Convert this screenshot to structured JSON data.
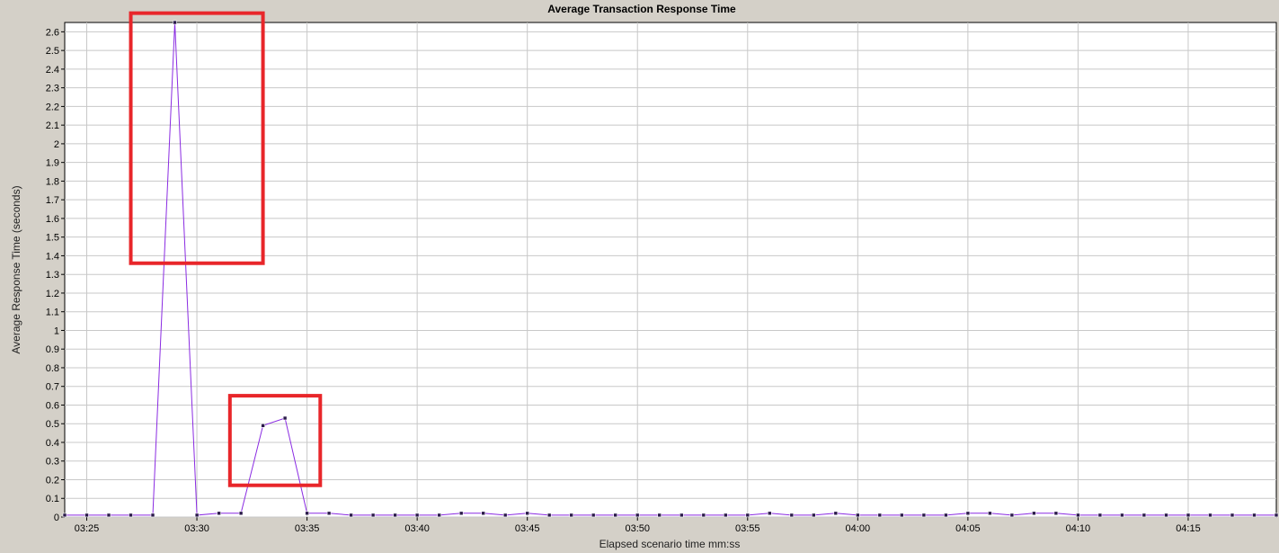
{
  "chart_data": {
    "type": "line",
    "title": "Average Transaction Response Time",
    "xlabel": "Elapsed scenario time mm:ss",
    "ylabel": "Average Response Time (seconds)",
    "x_unit": "mm:ss",
    "xlim": [
      "03:24",
      "04:19"
    ],
    "ylim": [
      0,
      2.65
    ],
    "x_ticks": [
      "03:25",
      "03:30",
      "03:35",
      "03:40",
      "03:45",
      "03:50",
      "03:55",
      "04:00",
      "04:05",
      "04:10",
      "04:15"
    ],
    "y_ticks": [
      "0",
      "0.1",
      "0.2",
      "0.3",
      "0.4",
      "0.5",
      "0.6",
      "0.7",
      "0.8",
      "0.9",
      "1",
      "1.1",
      "1.2",
      "1.3",
      "1.4",
      "1.5",
      "1.6",
      "1.7",
      "1.8",
      "1.9",
      "2",
      "2.1",
      "2.2",
      "2.3",
      "2.4",
      "2.5",
      "2.6"
    ],
    "grid": true,
    "series": [
      {
        "color": "#8a2be2",
        "x": [
          "03:24",
          "03:25",
          "03:26",
          "03:27",
          "03:28",
          "03:29",
          "03:30",
          "03:31",
          "03:32",
          "03:33",
          "03:34",
          "03:35",
          "03:36",
          "03:37",
          "03:38",
          "03:39",
          "03:40",
          "03:41",
          "03:42",
          "03:43",
          "03:44",
          "03:45",
          "03:46",
          "03:47",
          "03:48",
          "03:49",
          "03:50",
          "03:51",
          "03:52",
          "03:53",
          "03:54",
          "03:55",
          "03:56",
          "03:57",
          "03:58",
          "03:59",
          "04:00",
          "04:01",
          "04:02",
          "04:03",
          "04:04",
          "04:05",
          "04:06",
          "04:07",
          "04:08",
          "04:09",
          "04:10",
          "04:11",
          "04:12",
          "04:13",
          "04:14",
          "04:15",
          "04:16",
          "04:17",
          "04:18",
          "04:19"
        ],
        "y": [
          0.01,
          0.01,
          0.01,
          0.01,
          0.01,
          2.65,
          0.01,
          0.02,
          0.02,
          0.49,
          0.53,
          0.02,
          0.02,
          0.01,
          0.01,
          0.01,
          0.01,
          0.01,
          0.02,
          0.02,
          0.01,
          0.02,
          0.01,
          0.01,
          0.01,
          0.01,
          0.01,
          0.01,
          0.01,
          0.01,
          0.01,
          0.01,
          0.02,
          0.01,
          0.01,
          0.02,
          0.01,
          0.01,
          0.01,
          0.01,
          0.01,
          0.02,
          0.02,
          0.01,
          0.02,
          0.02,
          0.01,
          0.01,
          0.01,
          0.01,
          0.01,
          0.01,
          0.01,
          0.01,
          0.01,
          0.01
        ]
      }
    ],
    "annotations": [
      {
        "type": "rectangle",
        "color": "#e8262a",
        "x_range": [
          "03:27",
          "03:33"
        ],
        "y_range": [
          1.36,
          2.7
        ]
      },
      {
        "type": "rectangle",
        "color": "#e8262a",
        "x_range": [
          "03:31.5",
          "03:35.6"
        ],
        "y_range": [
          0.17,
          0.65
        ]
      }
    ]
  }
}
